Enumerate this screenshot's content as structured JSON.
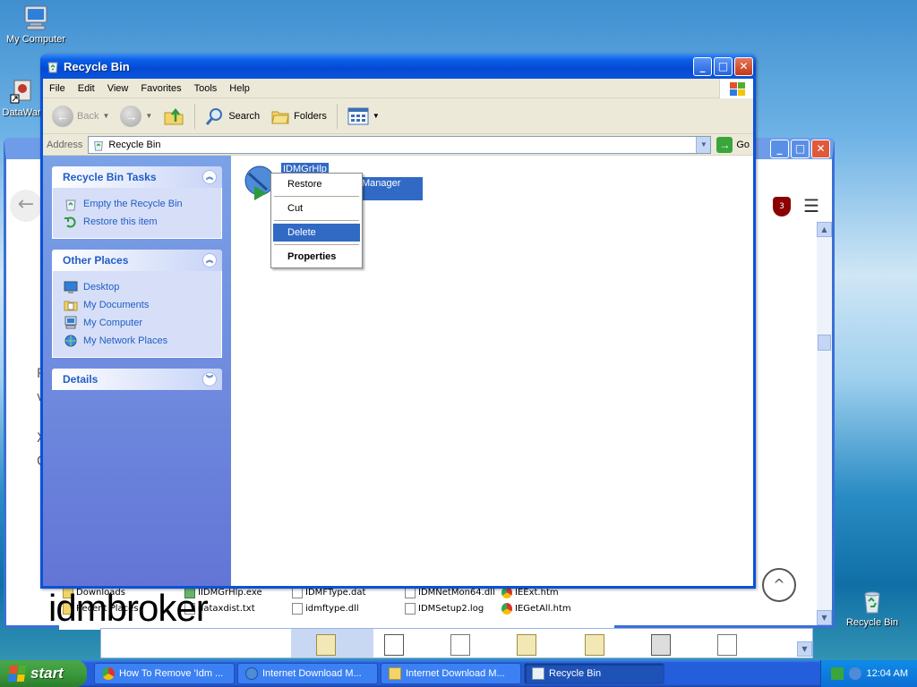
{
  "desktop": {
    "icons": [
      {
        "label": "My Computer"
      },
      {
        "label": "DataWar"
      },
      {
        "label": "Recycle Bin"
      }
    ]
  },
  "background_window": {
    "left_fragments": [
      "R",
      "v",
      "X",
      "C"
    ],
    "ublock_badge": "3"
  },
  "file_strip": {
    "items": [
      "Downloads",
      "IIDMGrHlp.exe",
      "IDMFType.dat",
      "IDMNetMon64.dll",
      "IEExt.htm",
      "Recent Places",
      "dataxdist.txt",
      "idmftype.dll",
      "IDMSetup2.log",
      "IEGetAll.htm"
    ],
    "brand": "idmbroker"
  },
  "window": {
    "title": "Recycle Bin",
    "menu": [
      "File",
      "Edit",
      "View",
      "Favorites",
      "Tools",
      "Help"
    ],
    "toolbar": {
      "back": "Back",
      "search": "Search",
      "folders": "Folders"
    },
    "address": {
      "label": "Address",
      "value": "Recycle Bin",
      "go": "Go"
    },
    "tasks_panel": {
      "title": "Recycle Bin Tasks",
      "items": [
        "Empty the Recycle Bin",
        "Restore this item"
      ]
    },
    "places_panel": {
      "title": "Other Places",
      "items": [
        "Desktop",
        "My Documents",
        "My Computer",
        "My Network Places"
      ]
    },
    "details_panel": {
      "title": "Details"
    },
    "file": {
      "name": "IDMGrHlp",
      "subtitle": "Manager m..."
    },
    "context_menu": [
      "Restore",
      "Cut",
      "Delete",
      "Properties"
    ]
  },
  "taskbar": {
    "start": "start",
    "tasks": [
      "How To Remove 'Idm ...",
      "Internet Download M...",
      "Internet Download M...",
      "Recycle Bin"
    ],
    "clock": "12:04 AM"
  },
  "colors": {
    "selection": "#316ac5",
    "titlebar": "#0a52d9",
    "taskpane_link": "#215dc6"
  }
}
